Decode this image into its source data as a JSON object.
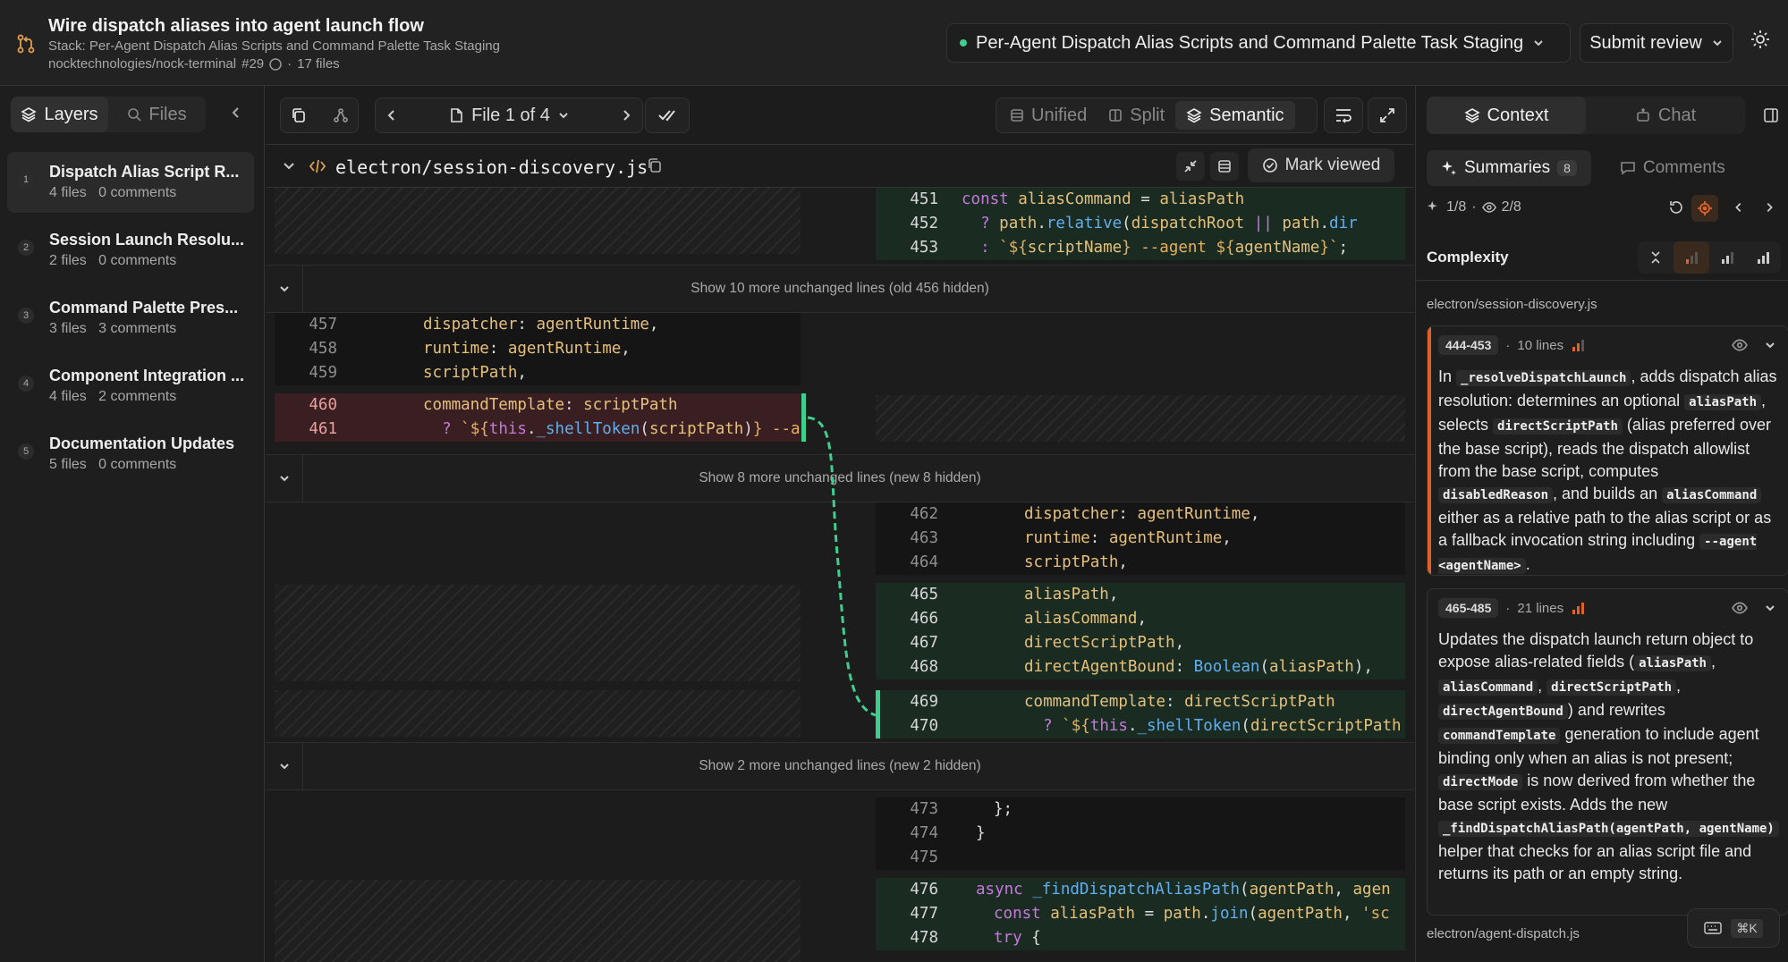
{
  "pr": {
    "title": "Wire dispatch aliases into agent launch flow",
    "stack": "Stack: Per-Agent Dispatch Alias Scripts and Command Palette Task Staging",
    "repo": "nocktechnologies/nock-terminal",
    "number": "#29",
    "files_count": "17 files",
    "separator": "·"
  },
  "header": {
    "stack_select": "Per-Agent Dispatch Alias Scripts and Command Palette Task Staging",
    "submit_review": "Submit review"
  },
  "sidebar": {
    "tabs": [
      "Layers",
      "Files"
    ],
    "layers": [
      {
        "num": "1",
        "title": "Dispatch Alias Script R...",
        "files": "4 files",
        "comments": "0 comments"
      },
      {
        "num": "2",
        "title": "Session Launch Resolu...",
        "files": "2 files",
        "comments": "0 comments"
      },
      {
        "num": "3",
        "title": "Command Palette Pres...",
        "files": "3 files",
        "comments": "3 comments"
      },
      {
        "num": "4",
        "title": "Component Integration ...",
        "files": "4 files",
        "comments": "2 comments"
      },
      {
        "num": "5",
        "title": "Documentation Updates",
        "files": "5 files",
        "comments": "0 comments"
      }
    ]
  },
  "toolbar": {
    "file_nav": "File 1 of 4",
    "views": [
      "Unified",
      "Split",
      "Semantic"
    ],
    "active_view": "Semantic"
  },
  "file": {
    "path": "electron/session-discovery.js",
    "mark_viewed": "Mark viewed"
  },
  "diff": {
    "top_right": [
      {
        "ln": "451",
        "code": "      const aliasCommand = aliasPath"
      },
      {
        "ln": "452",
        "code": "        ? path.relative(dispatchRoot || path.dir"
      },
      {
        "ln": "453",
        "code": "        : `${scriptName} --agent ${agentName}`;"
      }
    ],
    "expand1": "Show 10 more unchanged lines (old 456 hidden)",
    "ctx_left": [
      {
        "ln": "457",
        "code": "      dispatcher: agentRuntime,"
      },
      {
        "ln": "458",
        "code": "      runtime: agentRuntime,"
      },
      {
        "ln": "459",
        "code": "      scriptPath,"
      }
    ],
    "del_left": [
      {
        "ln": "460",
        "code": "      commandTemplate: scriptPath"
      },
      {
        "ln": "461",
        "code": "        ? `${this._shellToken(scriptPath)} --a"
      }
    ],
    "expand2": "Show 8 more unchanged lines (new 8 hidden)",
    "ctx_right": [
      {
        "ln": "462",
        "code": "      dispatcher: agentRuntime,"
      },
      {
        "ln": "463",
        "code": "      runtime: agentRuntime,"
      },
      {
        "ln": "464",
        "code": "      scriptPath,"
      }
    ],
    "add_right": [
      {
        "ln": "465",
        "code": "      aliasPath,"
      },
      {
        "ln": "466",
        "code": "      aliasCommand,"
      },
      {
        "ln": "467",
        "code": "      directScriptPath,"
      },
      {
        "ln": "468",
        "code": "      directAgentBound: Boolean(aliasPath),"
      }
    ],
    "add_right2": [
      {
        "ln": "469",
        "code": "      commandTemplate: directScriptPath"
      },
      {
        "ln": "470",
        "code": "        ? `${this._shellToken(directScriptPath"
      }
    ],
    "expand3": "Show 2 more unchanged lines (new 2 hidden)",
    "ctx_right2": [
      {
        "ln": "473",
        "code": "    };"
      },
      {
        "ln": "474",
        "code": "  }"
      },
      {
        "ln": "475",
        "code": ""
      }
    ],
    "add_right3": [
      {
        "ln": "476",
        "code": "  async _findDispatchAliasPath(agentPath, agen"
      },
      {
        "ln": "477",
        "code": "    const aliasPath = path.join(agentPath, 'sc"
      },
      {
        "ln": "478",
        "code": "    try {"
      }
    ]
  },
  "right": {
    "tabs": [
      "Context",
      "Chat"
    ],
    "subtabs": [
      "Summaries",
      "Comments"
    ],
    "summaries_count": "8",
    "nav_pos": "1/8",
    "nav_viewed": "2/8",
    "nav_sep": "·",
    "complexity_label": "Complexity",
    "file1": "electron/session-discovery.js",
    "file2": "electron/agent-dispatch.js",
    "cards": [
      {
        "range": "444-453",
        "lines": "10 lines"
      },
      {
        "range": "465-485",
        "lines": "21 lines"
      }
    ],
    "card1_text": {
      "t1": "In ",
      "c1": "_resolveDispatchLaunch",
      "t2": ", adds dispatch alias resolution: determines an optional ",
      "c2": "aliasPath",
      "t3": ", selects ",
      "c3": "directScriptPath",
      "t4": " (alias preferred over the base script), reads the dispatch allowlist from the base script, computes ",
      "c4": "disabledReason",
      "t5": ", and builds an ",
      "c5": "aliasCommand",
      "t6": " either as a relative path to the alias script or as a fallback invocation string including ",
      "c6": "--agent <agentName>",
      "t7": "."
    },
    "card2_text": {
      "t1": "Updates the dispatch launch return object to expose alias-related fields (",
      "c1": "aliasPath",
      "t2": ", ",
      "c2": "aliasCommand",
      "t3": ", ",
      "c3": "directScriptPath",
      "t4": ", ",
      "c4": "directAgentBound",
      "t5": ") and rewrites ",
      "c5": "commandTemplate",
      "t6": " generation to include agent binding only when an alias is not present; ",
      "c6": "directMode",
      "t7": " is now derived from whether the base script exists. Adds the new ",
      "c7": "_findDispatchAliasPath(agentPath, agentName)",
      "t8": " helper that checks for an alias script file and returns its path or an empty string."
    },
    "kbd": "⌘K"
  },
  "colors": {
    "accent_green": "#3ecf8e",
    "complexity_orange": "#e0622a"
  }
}
